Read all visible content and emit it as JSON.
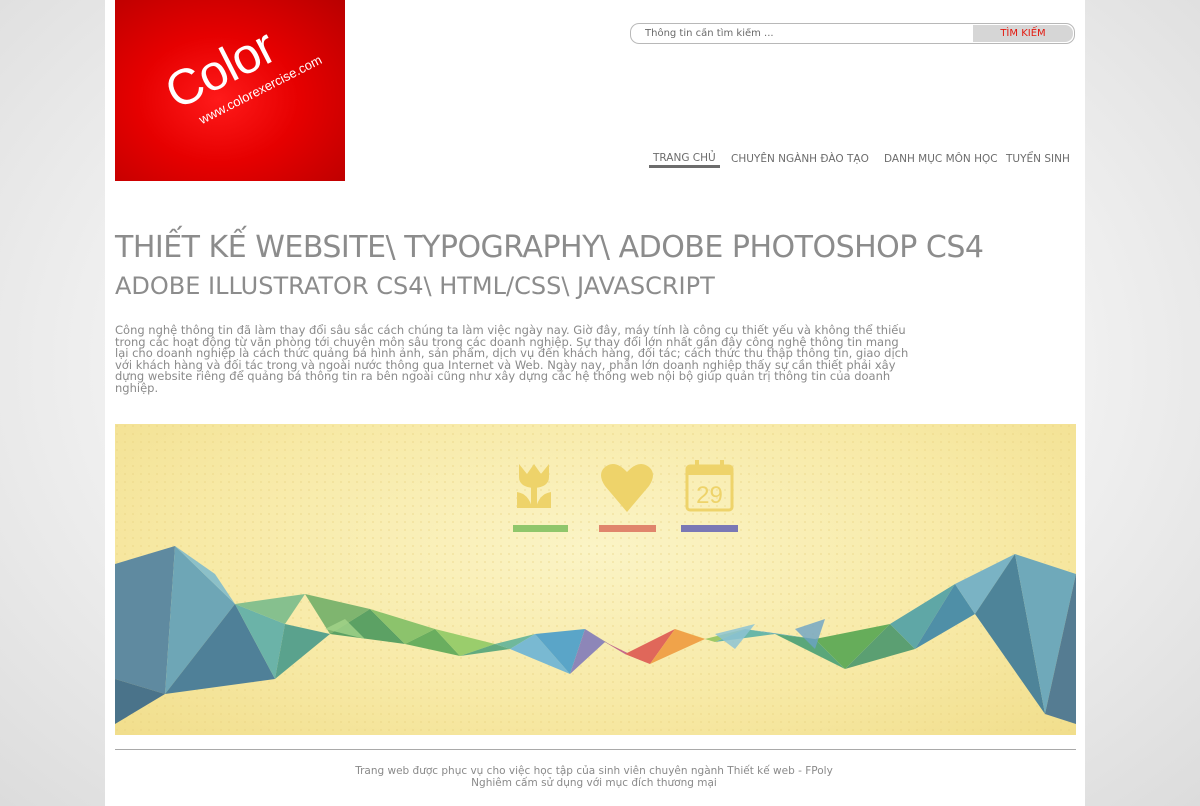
{
  "logo": {
    "word": "Color",
    "url": "www.colorexercise.com"
  },
  "search": {
    "placeholder": "Thông tin cần tìm kiếm ...",
    "button_label": "TÌM KIẾM"
  },
  "nav": {
    "items": [
      {
        "label": "TRANG CHỦ",
        "active": true
      },
      {
        "label": "CHUYÊN NGÀNH ĐÀO TẠO",
        "active": false
      },
      {
        "label": "DANH MỤC MÔN HỌC",
        "active": false
      },
      {
        "label": "TUYỂN SINH",
        "active": false
      }
    ]
  },
  "main": {
    "title_line1": "THIẾT KẾ WEBSITE\\ TYPOGRAPHY\\ ADOBE PHOTOSHOP CS4",
    "title_line2": "ADOBE ILLUSTRATOR CS4\\ HTML/CSS\\ JAVASCRIPT",
    "intro": "Công nghệ thông tin đã làm thay đổi sâu sắc cách chúng ta làm việc ngày nay. Giờ đây, máy tính là công cụ thiết yếu và không thể thiếu trong các hoạt động từ văn phòng tới chuyên môn sâu trong các doanh nghiệp. Sự thay đổi lớn nhất gần đây công nghệ thông tin mang lại cho doanh nghiệp là cách thức quảng bá hình ảnh, sản phẩm, dịch vụ đến khách hàng, đối tác; cách thức thu thập thông tin, giao dịch với khách hàng và đối tác trong và ngoài nước thông qua Internet và Web. Ngày nay, phần lớn doanh nghiệp thấy sự cần thiết phải xây dựng website riêng để quảng bá thông tin ra bên ngoài cũng như xây dựng các hệ thống web nội bộ giúp quản trị thông tin của doanh nghiệp."
  },
  "banner": {
    "icons": [
      {
        "name": "tulip-icon",
        "bar_color": "#8fc66b"
      },
      {
        "name": "heart-icon",
        "bar_color": "#e0856c"
      },
      {
        "name": "calendar-icon",
        "bar_color": "#7a78b5",
        "day": "29"
      }
    ],
    "icon_color": "#eed36a"
  },
  "footer": {
    "line1": "Trang web được phục vụ cho việc học tập của sinh viên chuyên ngành Thiết kế web - FPoly",
    "line2": "Nghiêm cấm sử dụng với mục đích thương mại"
  }
}
